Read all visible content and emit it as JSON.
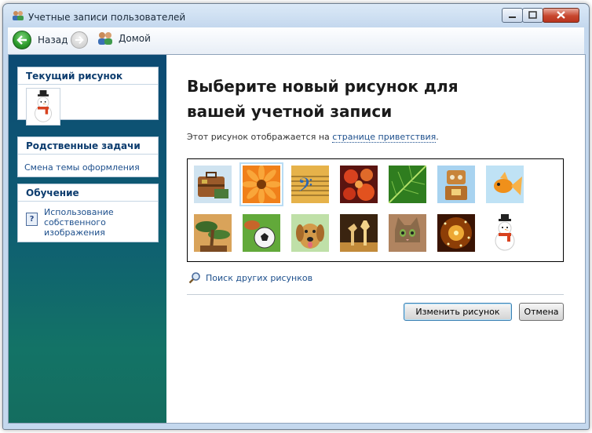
{
  "window": {
    "title": "Учетные записи пользователей"
  },
  "navbar": {
    "back_label": "Назад",
    "home_label": "Домой"
  },
  "sidebar": {
    "current_picture": {
      "heading": "Текущий рисунок",
      "image": "snowman"
    },
    "related_tasks": {
      "heading": "Родственные задачи",
      "items": [
        "Смена темы оформления"
      ]
    },
    "learning": {
      "heading": "Обучение",
      "items": [
        "Использование собственного изображения"
      ]
    }
  },
  "main": {
    "title": "Выберите новый рисунок для вашей учетной записи",
    "description_prefix": "Этот рисунок отображается на ",
    "description_link": "странице приветствия",
    "description_suffix": ".",
    "pictures": [
      "suitcase",
      "flower",
      "music-note",
      "starfish",
      "leaf",
      "robot",
      "goldfish",
      "bonsai",
      "soccer-ball",
      "dog",
      "chess",
      "kitten",
      "sparkles",
      "snowman"
    ],
    "selected_picture": "flower",
    "browse_link": "Поиск других рисунков",
    "change_button": "Изменить рисунок",
    "cancel_button": "Отмена"
  }
}
